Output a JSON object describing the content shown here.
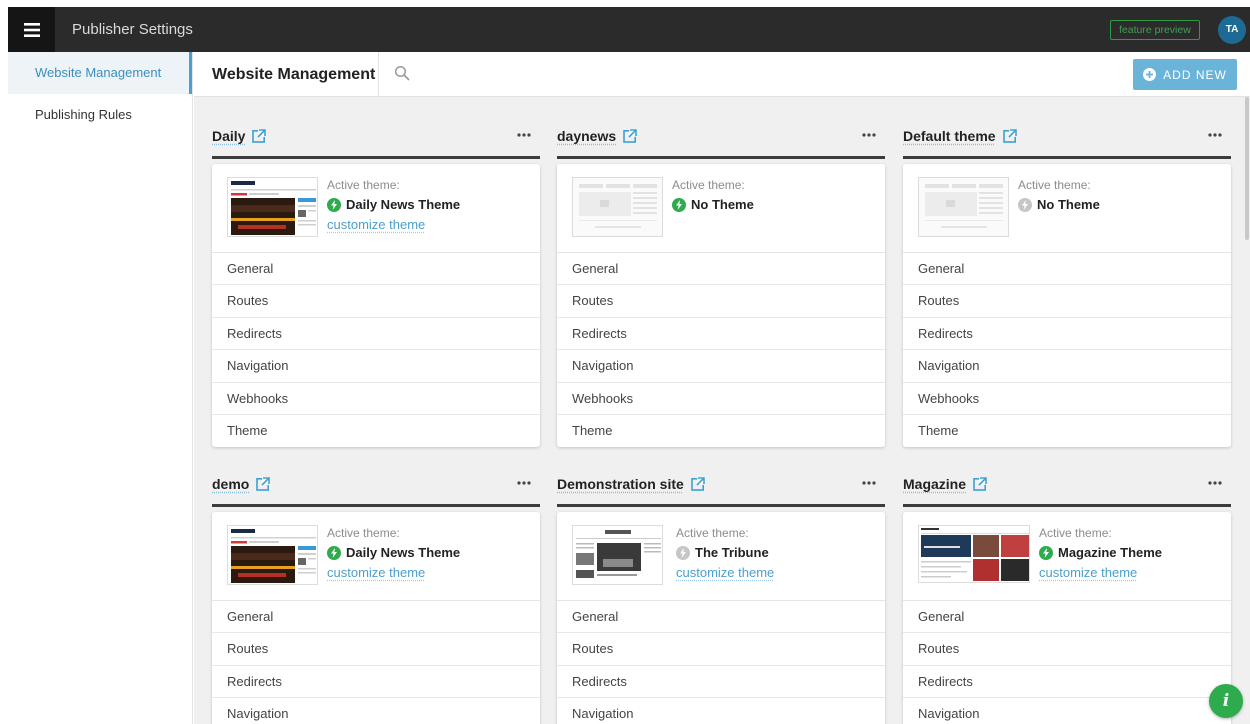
{
  "topbar": {
    "title": "Publisher Settings",
    "feature_preview": "feature preview",
    "avatar_initials": "TA"
  },
  "sidebar": {
    "items": [
      {
        "label": "Website Management"
      },
      {
        "label": "Publishing Rules"
      }
    ]
  },
  "header": {
    "title": "Website Management",
    "add_new_label": "ADD NEW"
  },
  "colors": {
    "accent": "#6bb4d9",
    "active_green": "#2eab4d",
    "inactive_gray": "#c6c6c6",
    "link_blue": "#4a9fce",
    "topbar": "#2b2b2b"
  },
  "active_theme_label": "Active theme:",
  "customize_label": "customize theme",
  "sites": [
    {
      "name": "Daily",
      "theme": "Daily News Theme",
      "status": "active",
      "thumbnail": "daily-news",
      "customizable": true,
      "menu": [
        "General",
        "Routes",
        "Redirects",
        "Navigation",
        "Webhooks",
        "Theme"
      ]
    },
    {
      "name": "daynews",
      "theme": "No Theme",
      "status": "active",
      "thumbnail": "placeholder",
      "customizable": false,
      "menu": [
        "General",
        "Routes",
        "Redirects",
        "Navigation",
        "Webhooks",
        "Theme"
      ]
    },
    {
      "name": "Default theme",
      "theme": "No Theme",
      "status": "inactive",
      "thumbnail": "placeholder",
      "customizable": false,
      "menu": [
        "General",
        "Routes",
        "Redirects",
        "Navigation",
        "Webhooks",
        "Theme"
      ]
    },
    {
      "name": "demo",
      "theme": "Daily News Theme",
      "status": "active",
      "thumbnail": "daily-news",
      "customizable": true,
      "menu": [
        "General",
        "Routes",
        "Redirects",
        "Navigation"
      ]
    },
    {
      "name": "Demonstration site",
      "theme": "The Tribune",
      "status": "inactive",
      "thumbnail": "tribune",
      "customizable": true,
      "menu": [
        "General",
        "Routes",
        "Redirects",
        "Navigation"
      ]
    },
    {
      "name": "Magazine",
      "theme": "Magazine Theme",
      "status": "active",
      "thumbnail": "magazine",
      "customizable": true,
      "menu": [
        "General",
        "Routes",
        "Redirects",
        "Navigation"
      ]
    }
  ],
  "fab": {
    "label": "i"
  }
}
